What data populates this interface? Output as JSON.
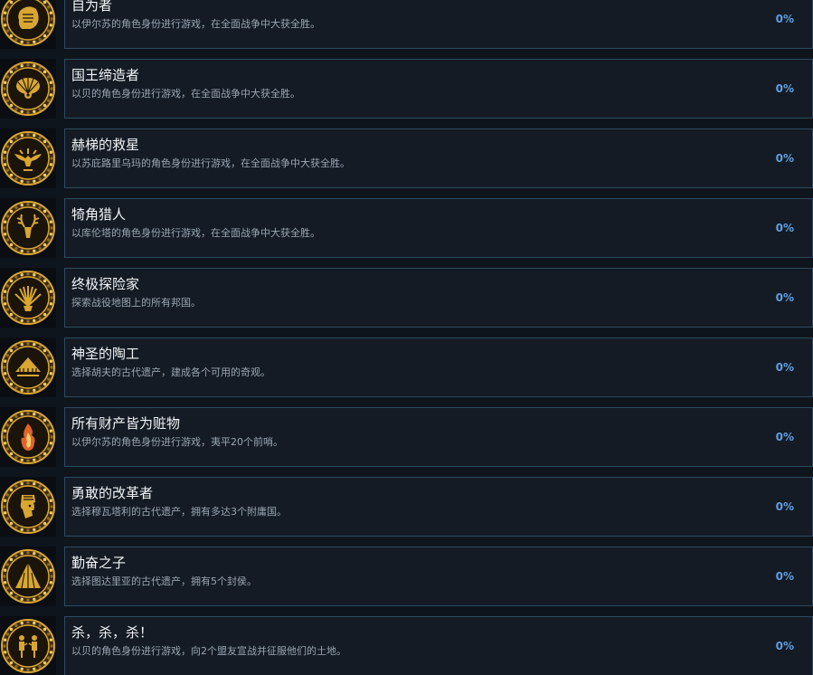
{
  "achievements": [
    {
      "title": "自为者",
      "desc": "以伊尔苏的角色身份进行游戏，在全面战争中大获全胜。",
      "percent": "0%",
      "icon": "lion-head-icon"
    },
    {
      "title": "国王缔造者",
      "desc": "以贝的角色身份进行游戏，在全面战争中大获全胜。",
      "percent": "0%",
      "icon": "peacock-fan-icon"
    },
    {
      "title": "赫梯的救星",
      "desc": "以苏庇路里乌玛的角色身份进行游戏，在全面战争中大获全胜。",
      "percent": "0%",
      "icon": "winged-eagle-icon"
    },
    {
      "title": "犄角猎人",
      "desc": "以库伦塔的角色身份进行游戏，在全面战争中大获全胜。",
      "percent": "0%",
      "icon": "stag-antlers-icon"
    },
    {
      "title": "终极探险家",
      "desc": "探索战役地图上的所有邦国。",
      "percent": "0%",
      "icon": "sunburst-icon"
    },
    {
      "title": "神圣的陶工",
      "desc": "选择胡夫的古代遗产，建成各个可用的奇观。",
      "percent": "0%",
      "icon": "pyramid-temple-icon"
    },
    {
      "title": "所有财产皆为赃物",
      "desc": "以伊尔苏的角色身份进行游戏，夷平20个前哨。",
      "percent": "0%",
      "icon": "flame-icon"
    },
    {
      "title": "勇敢的改革者",
      "desc": "选择穆瓦塔利的古代遗产，拥有多达3个附庸国。",
      "percent": "0%",
      "icon": "pharaoh-profile-icon"
    },
    {
      "title": "勤奋之子",
      "desc": "选择图达里亚的古代遗产，拥有5个封侯。",
      "percent": "0%",
      "icon": "pyramid-icon"
    },
    {
      "title": "杀，杀，杀！",
      "desc": "以贝的角色身份进行游戏，向2个盟友宣战并征服他们的土地。",
      "percent": "0%",
      "icon": "egyptian-figures-icon"
    }
  ]
}
